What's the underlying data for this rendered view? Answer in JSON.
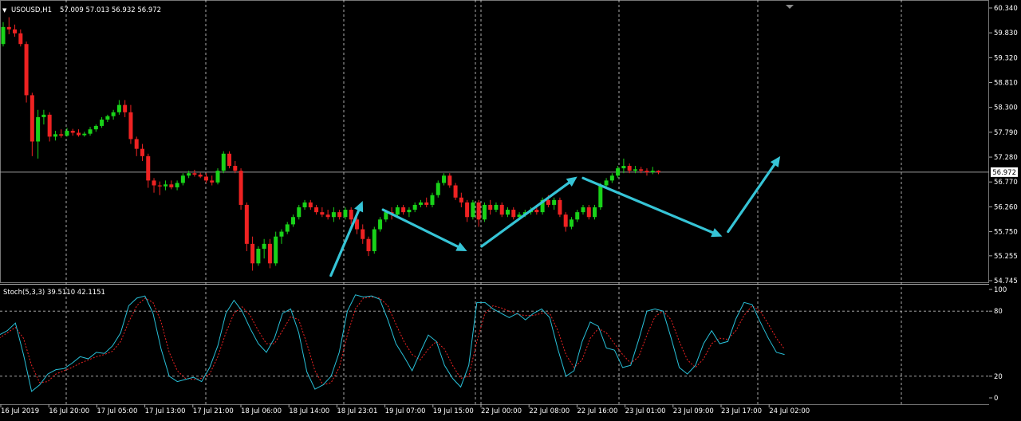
{
  "window": {
    "symbol": "USOUSD,H1",
    "ohlc": "57.009 57.013 56.932 56.972"
  },
  "indicator": {
    "label": "Stoch(5,3,3) 39.5110 42.1151"
  },
  "colors": {
    "background": "#000000",
    "grid": "#d7d7d7",
    "bull": "#19d219",
    "bear": "#ee2222",
    "arrow": "#36c4d6",
    "stoch_main": "#28c0d8",
    "stoch_signal": "#ee2222",
    "price_line": "#9a9a9a",
    "price_tag_bg": "#ffffff",
    "price_tag_text": "#000000",
    "axis_text": "#ffffff",
    "level_line": "#bcbcbc"
  },
  "chart_data": [
    {
      "type": "candlestick",
      "title": "USOUSD,H1",
      "ylim": [
        54.745,
        60.34
      ],
      "y_ticks": [
        "60.340",
        "59.830",
        "59.320",
        "58.810",
        "58.300",
        "57.790",
        "57.280",
        "56.770",
        "56.260",
        "55.750",
        "55.255",
        "54.745"
      ],
      "current_price": "56.972",
      "x_ticks": [
        "16 Jul 2019",
        "16 Jul 20:00",
        "17 Jul 05:00",
        "17 Jul 13:00",
        "17 Jul 21:00",
        "18 Jul 06:00",
        "18 Jul 14:00",
        "18 Jul 23:01",
        "19 Jul 07:00",
        "19 Jul 15:00",
        "22 Jul 00:00",
        "22 Jul 08:00",
        "22 Jul 16:00",
        "23 Jul 01:00",
        "23 Jul 09:00",
        "23 Jul 17:00",
        "24 Jul 02:00"
      ],
      "candles": [
        {
          "o": 59.6,
          "h": 60.05,
          "l": 59.55,
          "c": 59.95
        },
        {
          "o": 59.95,
          "h": 60.15,
          "l": 59.8,
          "c": 59.9
        },
        {
          "o": 59.9,
          "h": 60.0,
          "l": 59.75,
          "c": 59.82
        },
        {
          "o": 59.82,
          "h": 59.9,
          "l": 59.55,
          "c": 59.6
        },
        {
          "o": 59.6,
          "h": 59.65,
          "l": 58.4,
          "c": 58.55
        },
        {
          "o": 58.55,
          "h": 58.6,
          "l": 57.3,
          "c": 57.6
        },
        {
          "o": 57.6,
          "h": 58.25,
          "l": 57.25,
          "c": 58.1
        },
        {
          "o": 58.1,
          "h": 58.25,
          "l": 57.95,
          "c": 58.15
        },
        {
          "o": 58.15,
          "h": 58.2,
          "l": 57.6,
          "c": 57.7
        },
        {
          "o": 57.7,
          "h": 57.82,
          "l": 57.62,
          "c": 57.75
        },
        {
          "o": 57.75,
          "h": 57.85,
          "l": 57.68,
          "c": 57.72
        },
        {
          "o": 57.72,
          "h": 57.88,
          "l": 57.7,
          "c": 57.82
        },
        {
          "o": 57.82,
          "h": 57.86,
          "l": 57.72,
          "c": 57.78
        },
        {
          "o": 57.78,
          "h": 57.85,
          "l": 57.7,
          "c": 57.73
        },
        {
          "o": 57.73,
          "h": 57.8,
          "l": 57.7,
          "c": 57.76
        },
        {
          "o": 57.76,
          "h": 57.9,
          "l": 57.72,
          "c": 57.85
        },
        {
          "o": 57.85,
          "h": 57.95,
          "l": 57.8,
          "c": 57.92
        },
        {
          "o": 57.92,
          "h": 58.1,
          "l": 57.88,
          "c": 58.05
        },
        {
          "o": 58.05,
          "h": 58.15,
          "l": 58.0,
          "c": 58.12
        },
        {
          "o": 58.12,
          "h": 58.25,
          "l": 58.05,
          "c": 58.2
        },
        {
          "o": 58.2,
          "h": 58.45,
          "l": 58.15,
          "c": 58.35
        },
        {
          "o": 58.35,
          "h": 58.45,
          "l": 58.1,
          "c": 58.2
        },
        {
          "o": 58.2,
          "h": 58.35,
          "l": 57.55,
          "c": 57.65
        },
        {
          "o": 57.65,
          "h": 57.7,
          "l": 57.3,
          "c": 57.45
        },
        {
          "o": 57.45,
          "h": 57.55,
          "l": 57.2,
          "c": 57.3
        },
        {
          "o": 57.3,
          "h": 57.35,
          "l": 56.65,
          "c": 56.8
        },
        {
          "o": 56.8,
          "h": 56.85,
          "l": 56.55,
          "c": 56.7
        },
        {
          "o": 56.7,
          "h": 56.78,
          "l": 56.5,
          "c": 56.68
        },
        {
          "o": 56.68,
          "h": 56.8,
          "l": 56.6,
          "c": 56.72
        },
        {
          "o": 56.72,
          "h": 56.8,
          "l": 56.62,
          "c": 56.66
        },
        {
          "o": 56.66,
          "h": 56.8,
          "l": 56.6,
          "c": 56.75
        },
        {
          "o": 56.75,
          "h": 56.95,
          "l": 56.7,
          "c": 56.9
        },
        {
          "o": 56.9,
          "h": 57.0,
          "l": 56.85,
          "c": 56.95
        },
        {
          "o": 56.95,
          "h": 57.02,
          "l": 56.88,
          "c": 56.92
        },
        {
          "o": 56.92,
          "h": 56.96,
          "l": 56.85,
          "c": 56.88
        },
        {
          "o": 56.88,
          "h": 56.95,
          "l": 56.75,
          "c": 56.8
        },
        {
          "o": 56.8,
          "h": 56.9,
          "l": 56.7,
          "c": 56.76
        },
        {
          "o": 56.76,
          "h": 57.05,
          "l": 56.72,
          "c": 57.0
        },
        {
          "o": 57.0,
          "h": 57.4,
          "l": 56.95,
          "c": 57.35
        },
        {
          "o": 57.35,
          "h": 57.4,
          "l": 57.05,
          "c": 57.1
        },
        {
          "o": 57.1,
          "h": 57.2,
          "l": 56.95,
          "c": 57.0
        },
        {
          "o": 57.0,
          "h": 57.05,
          "l": 56.2,
          "c": 56.3
        },
        {
          "o": 56.3,
          "h": 56.35,
          "l": 55.35,
          "c": 55.5
        },
        {
          "o": 55.5,
          "h": 55.65,
          "l": 54.95,
          "c": 55.1
        },
        {
          "o": 55.1,
          "h": 55.45,
          "l": 55.05,
          "c": 55.4
        },
        {
          "o": 55.4,
          "h": 55.6,
          "l": 55.2,
          "c": 55.5
        },
        {
          "o": 55.5,
          "h": 55.6,
          "l": 55.0,
          "c": 55.1
        },
        {
          "o": 55.1,
          "h": 55.75,
          "l": 55.05,
          "c": 55.65
        },
        {
          "o": 55.65,
          "h": 55.8,
          "l": 55.5,
          "c": 55.75
        },
        {
          "o": 55.75,
          "h": 55.95,
          "l": 55.7,
          "c": 55.9
        },
        {
          "o": 55.9,
          "h": 56.1,
          "l": 55.85,
          "c": 56.05
        },
        {
          "o": 56.05,
          "h": 56.3,
          "l": 56.0,
          "c": 56.25
        },
        {
          "o": 56.25,
          "h": 56.4,
          "l": 56.2,
          "c": 56.35
        },
        {
          "o": 56.35,
          "h": 56.4,
          "l": 56.2,
          "c": 56.25
        },
        {
          "o": 56.25,
          "h": 56.3,
          "l": 56.1,
          "c": 56.15
        },
        {
          "o": 56.15,
          "h": 56.25,
          "l": 56.05,
          "c": 56.1
        },
        {
          "o": 56.1,
          "h": 56.2,
          "l": 56.0,
          "c": 56.05
        },
        {
          "o": 56.05,
          "h": 56.25,
          "l": 55.95,
          "c": 56.15
        },
        {
          "o": 56.15,
          "h": 56.2,
          "l": 56.0,
          "c": 56.05
        },
        {
          "o": 56.05,
          "h": 56.25,
          "l": 56.0,
          "c": 56.2
        },
        {
          "o": 56.2,
          "h": 56.25,
          "l": 55.9,
          "c": 56.0
        },
        {
          "o": 56.0,
          "h": 56.1,
          "l": 55.7,
          "c": 55.8
        },
        {
          "o": 55.8,
          "h": 55.9,
          "l": 55.5,
          "c": 55.6
        },
        {
          "o": 55.6,
          "h": 55.65,
          "l": 55.25,
          "c": 55.35
        },
        {
          "o": 55.35,
          "h": 55.85,
          "l": 55.3,
          "c": 55.8
        },
        {
          "o": 55.8,
          "h": 56.05,
          "l": 55.75,
          "c": 56.0
        },
        {
          "o": 56.0,
          "h": 56.2,
          "l": 55.95,
          "c": 56.15
        },
        {
          "o": 56.15,
          "h": 56.25,
          "l": 56.0,
          "c": 56.1
        },
        {
          "o": 56.1,
          "h": 56.3,
          "l": 56.05,
          "c": 56.25
        },
        {
          "o": 56.25,
          "h": 56.3,
          "l": 56.1,
          "c": 56.15
        },
        {
          "o": 56.15,
          "h": 56.25,
          "l": 56.05,
          "c": 56.2
        },
        {
          "o": 56.2,
          "h": 56.35,
          "l": 56.15,
          "c": 56.3
        },
        {
          "o": 56.3,
          "h": 56.4,
          "l": 56.25,
          "c": 56.35
        },
        {
          "o": 56.35,
          "h": 56.45,
          "l": 56.25,
          "c": 56.3
        },
        {
          "o": 56.3,
          "h": 56.55,
          "l": 56.25,
          "c": 56.5
        },
        {
          "o": 56.5,
          "h": 56.8,
          "l": 56.45,
          "c": 56.75
        },
        {
          "o": 56.75,
          "h": 56.95,
          "l": 56.7,
          "c": 56.9
        },
        {
          "o": 56.9,
          "h": 56.95,
          "l": 56.65,
          "c": 56.7
        },
        {
          "o": 56.7,
          "h": 56.75,
          "l": 56.4,
          "c": 56.45
        },
        {
          "o": 56.45,
          "h": 56.55,
          "l": 56.25,
          "c": 56.35
        },
        {
          "o": 56.35,
          "h": 56.4,
          "l": 55.95,
          "c": 56.05
        },
        {
          "o": 56.05,
          "h": 56.4,
          "l": 56.0,
          "c": 56.35
        },
        {
          "o": 56.35,
          "h": 56.4,
          "l": 55.85,
          "c": 56.0
        },
        {
          "o": 56.0,
          "h": 56.35,
          "l": 55.95,
          "c": 56.3
        },
        {
          "o": 56.3,
          "h": 56.4,
          "l": 56.1,
          "c": 56.2
        },
        {
          "o": 56.2,
          "h": 56.35,
          "l": 56.15,
          "c": 56.3
        },
        {
          "o": 56.3,
          "h": 56.35,
          "l": 56.05,
          "c": 56.1
        },
        {
          "o": 56.1,
          "h": 56.25,
          "l": 56.05,
          "c": 56.2
        },
        {
          "o": 56.2,
          "h": 56.25,
          "l": 56.0,
          "c": 56.05
        },
        {
          "o": 56.05,
          "h": 56.15,
          "l": 56.0,
          "c": 56.1
        },
        {
          "o": 56.1,
          "h": 56.2,
          "l": 56.05,
          "c": 56.15
        },
        {
          "o": 56.15,
          "h": 56.25,
          "l": 56.1,
          "c": 56.2
        },
        {
          "o": 56.2,
          "h": 56.3,
          "l": 56.1,
          "c": 56.15
        },
        {
          "o": 56.15,
          "h": 56.45,
          "l": 56.1,
          "c": 56.4
        },
        {
          "o": 56.4,
          "h": 56.5,
          "l": 56.25,
          "c": 56.3
        },
        {
          "o": 56.3,
          "h": 56.45,
          "l": 56.2,
          "c": 56.4
        },
        {
          "o": 56.4,
          "h": 56.45,
          "l": 56.05,
          "c": 56.1
        },
        {
          "o": 56.1,
          "h": 56.15,
          "l": 55.75,
          "c": 55.85
        },
        {
          "o": 55.85,
          "h": 56.05,
          "l": 55.8,
          "c": 56.0
        },
        {
          "o": 56.0,
          "h": 56.2,
          "l": 55.95,
          "c": 56.15
        },
        {
          "o": 56.15,
          "h": 56.3,
          "l": 56.1,
          "c": 56.25
        },
        {
          "o": 56.25,
          "h": 56.3,
          "l": 56.0,
          "c": 56.05
        },
        {
          "o": 56.05,
          "h": 56.3,
          "l": 56.0,
          "c": 56.25
        },
        {
          "o": 56.25,
          "h": 56.75,
          "l": 56.2,
          "c": 56.7
        },
        {
          "o": 56.7,
          "h": 56.85,
          "l": 56.65,
          "c": 56.8
        },
        {
          "o": 56.8,
          "h": 56.95,
          "l": 56.75,
          "c": 56.9
        },
        {
          "o": 56.9,
          "h": 57.1,
          "l": 56.85,
          "c": 57.05
        },
        {
          "o": 57.05,
          "h": 57.25,
          "l": 56.95,
          "c": 57.1
        },
        {
          "o": 57.1,
          "h": 57.15,
          "l": 56.95,
          "c": 57.0
        },
        {
          "o": 57.0,
          "h": 57.1,
          "l": 56.95,
          "c": 57.03
        },
        {
          "o": 57.03,
          "h": 57.08,
          "l": 56.95,
          "c": 57.0
        },
        {
          "o": 57.0,
          "h": 57.05,
          "l": 56.9,
          "c": 56.97
        },
        {
          "o": 56.97,
          "h": 57.08,
          "l": 56.93,
          "c": 57.0
        },
        {
          "o": 57.0,
          "h": 57.01,
          "l": 56.93,
          "c": 56.97
        }
      ],
      "arrows": [
        {
          "from": [
            56.5,
            54.85
          ],
          "to": [
            62.0,
            56.38
          ]
        },
        {
          "from": [
            65.5,
            56.2
          ],
          "to": [
            80.0,
            55.35
          ]
        },
        {
          "from": [
            82.5,
            55.45
          ],
          "to": [
            99.0,
            56.88
          ]
        },
        {
          "from": [
            100.0,
            56.85
          ],
          "to": [
            124.0,
            55.65
          ]
        },
        {
          "from": [
            125.0,
            55.75
          ],
          "to": [
            134.0,
            57.3
          ]
        }
      ]
    },
    {
      "type": "line",
      "title": "Stoch(5,3,3) 39.5110 42.1151",
      "ylim": [
        0,
        100
      ],
      "y_ticks": [
        "100",
        "80",
        "20",
        "0"
      ],
      "levels": [
        80,
        20
      ],
      "series": [
        {
          "values": [
            58,
            62,
            69,
            40,
            6,
            12,
            22,
            26,
            27,
            32,
            38,
            36,
            42,
            41,
            48,
            60,
            85,
            92,
            94,
            78,
            45,
            20,
            15,
            17,
            19,
            15,
            28,
            48,
            78,
            90,
            80,
            64,
            50,
            42,
            55,
            78,
            82,
            60,
            24,
            8,
            12,
            20,
            42,
            80,
            95,
            93,
            94,
            91,
            72,
            50,
            38,
            25,
            42,
            58,
            52,
            30,
            18,
            10,
            30,
            88,
            88,
            82,
            78,
            74,
            78,
            72,
            78,
            82,
            74,
            45,
            20,
            25,
            52,
            70,
            66,
            46,
            44,
            28,
            30,
            54,
            80,
            82,
            80,
            55,
            28,
            22,
            30,
            50,
            62,
            50,
            52,
            73,
            88,
            86,
            70,
            55,
            42,
            40
          ]
        },
        {
          "values": [
            55,
            60,
            65,
            55,
            30,
            14,
            15,
            22,
            25,
            28,
            32,
            35,
            38,
            40,
            43,
            52,
            70,
            85,
            92,
            88,
            70,
            42,
            25,
            18,
            17,
            18,
            22,
            38,
            60,
            78,
            84,
            76,
            62,
            50,
            50,
            62,
            75,
            72,
            50,
            25,
            12,
            14,
            28,
            58,
            82,
            92,
            93,
            92,
            85,
            68,
            52,
            40,
            35,
            45,
            52,
            45,
            30,
            18,
            20,
            52,
            78,
            85,
            83,
            80,
            77,
            76,
            76,
            78,
            78,
            62,
            40,
            28,
            35,
            55,
            64,
            60,
            50,
            40,
            32,
            38,
            58,
            75,
            80,
            72,
            52,
            35,
            28,
            36,
            50,
            55,
            54,
            62,
            76,
            85,
            80,
            68,
            55,
            45
          ]
        }
      ]
    }
  ]
}
